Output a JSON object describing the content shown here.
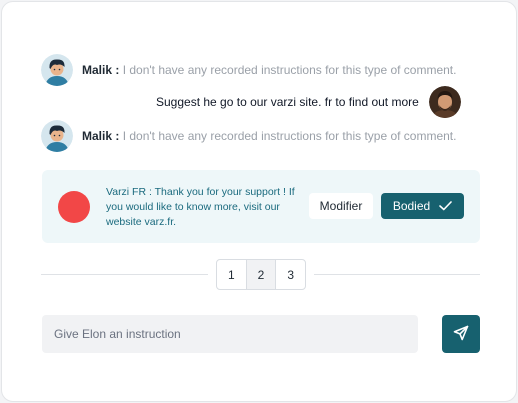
{
  "chat": {
    "messages": [
      {
        "author": "Malik :",
        "text": "I don't have any recorded instructions for this type of comment."
      },
      {
        "text": "Suggest he go to our varzi site. fr to find out more"
      },
      {
        "author": "Malik :",
        "text": "I don't have any recorded instructions for this type of comment."
      }
    ]
  },
  "bot": {
    "text": "Varzi FR : Thank you for your support ! If you would like to know more, visit our website varz.fr.",
    "modify_label": "Modifier",
    "bodied_label": "Bodied",
    "dot_color": "#f24747"
  },
  "pagination": {
    "pages": [
      "1",
      "2",
      "3"
    ],
    "active": "2"
  },
  "composer": {
    "placeholder": "Give Elon an instruction"
  },
  "colors": {
    "accent": "#17616f",
    "panel": "#eef7f9"
  }
}
